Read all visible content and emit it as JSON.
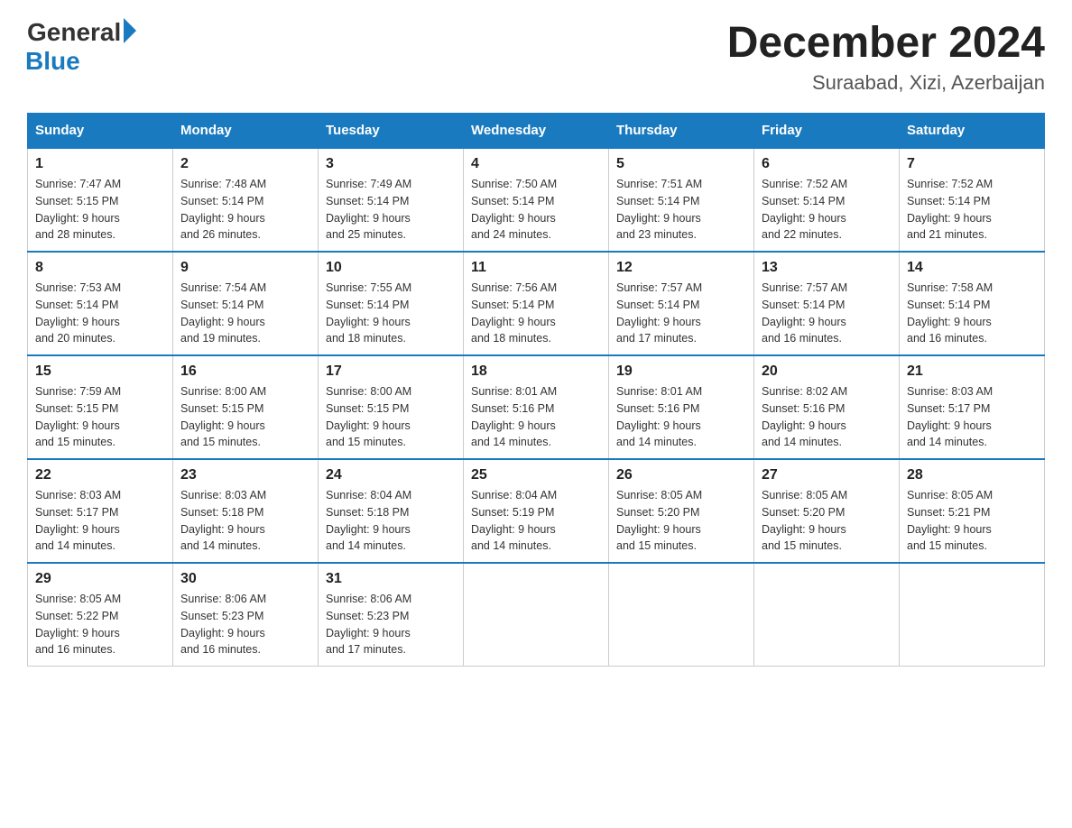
{
  "logo": {
    "general": "General",
    "blue": "Blue"
  },
  "header": {
    "month_year": "December 2024",
    "location": "Suraabad, Xizi, Azerbaijan"
  },
  "days_of_week": [
    "Sunday",
    "Monday",
    "Tuesday",
    "Wednesday",
    "Thursday",
    "Friday",
    "Saturday"
  ],
  "weeks": [
    [
      {
        "day": "1",
        "sunrise": "7:47 AM",
        "sunset": "5:15 PM",
        "daylight": "9 hours and 28 minutes."
      },
      {
        "day": "2",
        "sunrise": "7:48 AM",
        "sunset": "5:14 PM",
        "daylight": "9 hours and 26 minutes."
      },
      {
        "day": "3",
        "sunrise": "7:49 AM",
        "sunset": "5:14 PM",
        "daylight": "9 hours and 25 minutes."
      },
      {
        "day": "4",
        "sunrise": "7:50 AM",
        "sunset": "5:14 PM",
        "daylight": "9 hours and 24 minutes."
      },
      {
        "day": "5",
        "sunrise": "7:51 AM",
        "sunset": "5:14 PM",
        "daylight": "9 hours and 23 minutes."
      },
      {
        "day": "6",
        "sunrise": "7:52 AM",
        "sunset": "5:14 PM",
        "daylight": "9 hours and 22 minutes."
      },
      {
        "day": "7",
        "sunrise": "7:52 AM",
        "sunset": "5:14 PM",
        "daylight": "9 hours and 21 minutes."
      }
    ],
    [
      {
        "day": "8",
        "sunrise": "7:53 AM",
        "sunset": "5:14 PM",
        "daylight": "9 hours and 20 minutes."
      },
      {
        "day": "9",
        "sunrise": "7:54 AM",
        "sunset": "5:14 PM",
        "daylight": "9 hours and 19 minutes."
      },
      {
        "day": "10",
        "sunrise": "7:55 AM",
        "sunset": "5:14 PM",
        "daylight": "9 hours and 18 minutes."
      },
      {
        "day": "11",
        "sunrise": "7:56 AM",
        "sunset": "5:14 PM",
        "daylight": "9 hours and 18 minutes."
      },
      {
        "day": "12",
        "sunrise": "7:57 AM",
        "sunset": "5:14 PM",
        "daylight": "9 hours and 17 minutes."
      },
      {
        "day": "13",
        "sunrise": "7:57 AM",
        "sunset": "5:14 PM",
        "daylight": "9 hours and 16 minutes."
      },
      {
        "day": "14",
        "sunrise": "7:58 AM",
        "sunset": "5:14 PM",
        "daylight": "9 hours and 16 minutes."
      }
    ],
    [
      {
        "day": "15",
        "sunrise": "7:59 AM",
        "sunset": "5:15 PM",
        "daylight": "9 hours and 15 minutes."
      },
      {
        "day": "16",
        "sunrise": "8:00 AM",
        "sunset": "5:15 PM",
        "daylight": "9 hours and 15 minutes."
      },
      {
        "day": "17",
        "sunrise": "8:00 AM",
        "sunset": "5:15 PM",
        "daylight": "9 hours and 15 minutes."
      },
      {
        "day": "18",
        "sunrise": "8:01 AM",
        "sunset": "5:16 PM",
        "daylight": "9 hours and 14 minutes."
      },
      {
        "day": "19",
        "sunrise": "8:01 AM",
        "sunset": "5:16 PM",
        "daylight": "9 hours and 14 minutes."
      },
      {
        "day": "20",
        "sunrise": "8:02 AM",
        "sunset": "5:16 PM",
        "daylight": "9 hours and 14 minutes."
      },
      {
        "day": "21",
        "sunrise": "8:03 AM",
        "sunset": "5:17 PM",
        "daylight": "9 hours and 14 minutes."
      }
    ],
    [
      {
        "day": "22",
        "sunrise": "8:03 AM",
        "sunset": "5:17 PM",
        "daylight": "9 hours and 14 minutes."
      },
      {
        "day": "23",
        "sunrise": "8:03 AM",
        "sunset": "5:18 PM",
        "daylight": "9 hours and 14 minutes."
      },
      {
        "day": "24",
        "sunrise": "8:04 AM",
        "sunset": "5:18 PM",
        "daylight": "9 hours and 14 minutes."
      },
      {
        "day": "25",
        "sunrise": "8:04 AM",
        "sunset": "5:19 PM",
        "daylight": "9 hours and 14 minutes."
      },
      {
        "day": "26",
        "sunrise": "8:05 AM",
        "sunset": "5:20 PM",
        "daylight": "9 hours and 15 minutes."
      },
      {
        "day": "27",
        "sunrise": "8:05 AM",
        "sunset": "5:20 PM",
        "daylight": "9 hours and 15 minutes."
      },
      {
        "day": "28",
        "sunrise": "8:05 AM",
        "sunset": "5:21 PM",
        "daylight": "9 hours and 15 minutes."
      }
    ],
    [
      {
        "day": "29",
        "sunrise": "8:05 AM",
        "sunset": "5:22 PM",
        "daylight": "9 hours and 16 minutes."
      },
      {
        "day": "30",
        "sunrise": "8:06 AM",
        "sunset": "5:23 PM",
        "daylight": "9 hours and 16 minutes."
      },
      {
        "day": "31",
        "sunrise": "8:06 AM",
        "sunset": "5:23 PM",
        "daylight": "9 hours and 17 minutes."
      },
      null,
      null,
      null,
      null
    ]
  ],
  "labels": {
    "sunrise": "Sunrise:",
    "sunset": "Sunset:",
    "daylight": "Daylight:"
  }
}
